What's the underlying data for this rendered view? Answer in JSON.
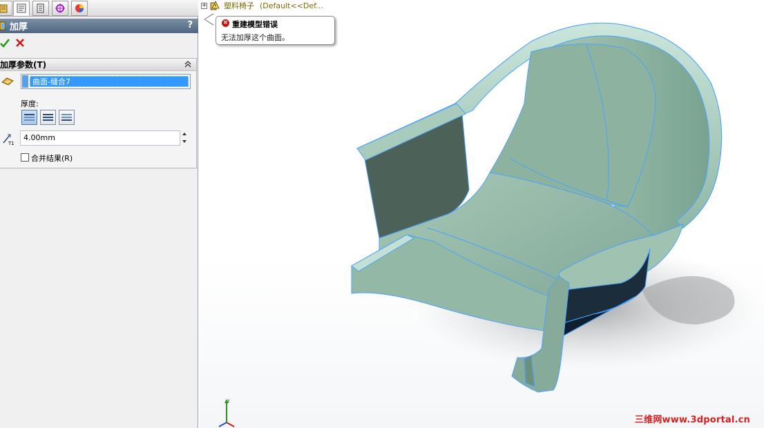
{
  "panel": {
    "tabs": [
      {
        "name": "featuremanager-tab-icon"
      },
      {
        "name": "propertymanager-tab-icon"
      },
      {
        "name": "configurationmanager-tab-icon"
      },
      {
        "name": "dimxpert-tab-icon"
      },
      {
        "name": "display-manager-tab-icon"
      }
    ],
    "title": "加厚",
    "help": "?",
    "group_title": "加厚参数(T)",
    "selected_surface": "曲面-缝合7",
    "thickness_label": "厚度:",
    "thickness_value": "4.00mm",
    "merge_label": "合并结果(R)",
    "merge_checked": false
  },
  "graphics": {
    "tree_expander": "+",
    "part_name": "塑料椅子",
    "config": "(Default<<Def...",
    "error_title": "重建模型错误",
    "error_message": "无法加厚这个曲面。",
    "watermark": "三维网www.3dportal.cn"
  },
  "colors": {
    "accent": "#3399ff",
    "error": "#cc1111",
    "model_face": "#8fb3a3",
    "model_edge": "#4aa3ff",
    "watermark": "#d81e1e"
  }
}
